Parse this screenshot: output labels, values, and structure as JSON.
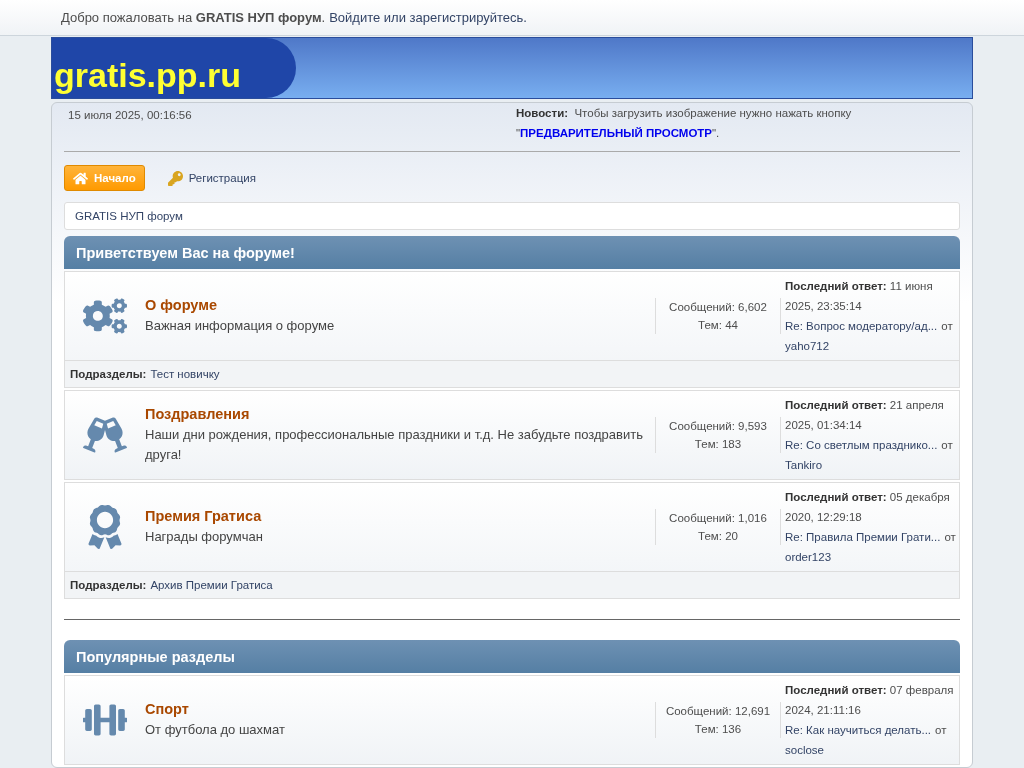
{
  "top_bar": {
    "welcome": "Добро пожаловать на **GRATIS НУП форум**.",
    "login_link": "Войдите или зарегистрируйтесь."
  },
  "header": {
    "logo": "gratis.pp.ru"
  },
  "info": {
    "datetime": "15 июля 2025, 00:16:56",
    "news_text": "**Новости:**  Чтобы загрузить изображение нужно нажать кнопку \"**ПРЕДВАРИТЕЛЬНЫЙ ПРОСМОТР**\"."
  },
  "menu": [
    {
      "label": "Начало",
      "kind": "home",
      "selected": true
    },
    {
      "label": "Регистрация",
      "kind": "key",
      "selected": false
    }
  ],
  "breadcrumb": "GRATIS НУП форум",
  "categories": [
    {
      "title": "Приветствуем Вас на форуме!",
      "boards": [
        {
          "kind": "gears",
          "name": "О форуме",
          "description": "Важная информация о форуме",
          "posts": "Сообщений: 6,602",
          "topics": "Тем: 44",
          "last_post": "**Последний ответ:** 11 июня 2025, 23:35:14",
          "topic": "Re: Вопрос модератору/ад...",
          "by": "от",
          "user": "yaho712",
          "subboards_label": "Подразделы:",
          "subboards": [
            "Тест новичку"
          ]
        },
        {
          "kind": "glasses",
          "name": "Поздравления",
          "description": "Наши дни рождения, профессиональные праздники и т.д. Не забудьте поздравить друга!",
          "posts": "Сообщений: 9,593",
          "topics": "Тем: 183",
          "last_post": "**Последний ответ:** 21 апреля 2025, 01:34:14",
          "topic": "Re: Со светлым празднико...",
          "by": "от",
          "user": "Tankiro"
        },
        {
          "kind": "award",
          "name": "Премия Гратиса",
          "description": "Награды форумчан",
          "posts": "Сообщений: 1,016",
          "topics": "Тем: 20",
          "last_post": "**Последний ответ:** 05 декабря 2020, 12:29:18",
          "topic": "Re: Правила Премии Грати...",
          "by": "от",
          "user": "order123",
          "subboards_label": "Подразделы:",
          "subboards": [
            "Архив Премии Гратиса"
          ]
        }
      ]
    },
    {
      "title": "Популярные разделы",
      "boards": [
        {
          "kind": "dumbbell",
          "name": "Спорт",
          "description": "От футбола до шахмат",
          "posts": "Сообщений: 12,691",
          "topics": "Тем: 136",
          "last_post": "**Последний ответ:** 07 февраля 2024, 21:11:16",
          "topic": "Re: Как научиться делать...",
          "by": "от",
          "user": "soclose"
        }
      ]
    }
  ]
}
